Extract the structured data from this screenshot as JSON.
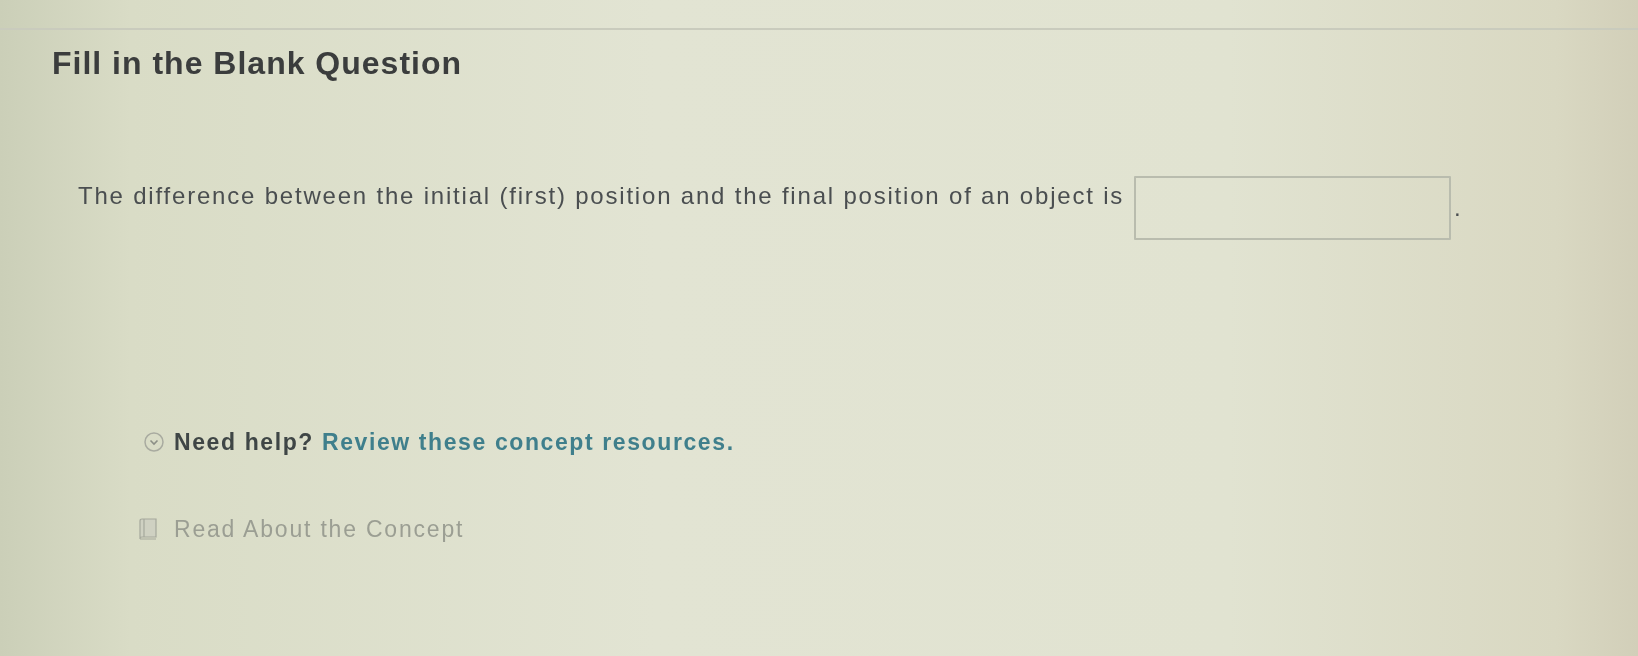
{
  "title": "Fill in the Blank Question",
  "question": {
    "parts": [
      {
        "kind": "text",
        "text": "The difference between the initial (first) position and the final position of an object is"
      },
      {
        "kind": "blank"
      },
      {
        "kind": "text",
        "text": "."
      }
    ]
  },
  "help": {
    "prompt": "Need help?",
    "link": "Review these concept resources.",
    "expanded": true
  },
  "resources": [
    {
      "label": "Read About the Concept"
    }
  ]
}
